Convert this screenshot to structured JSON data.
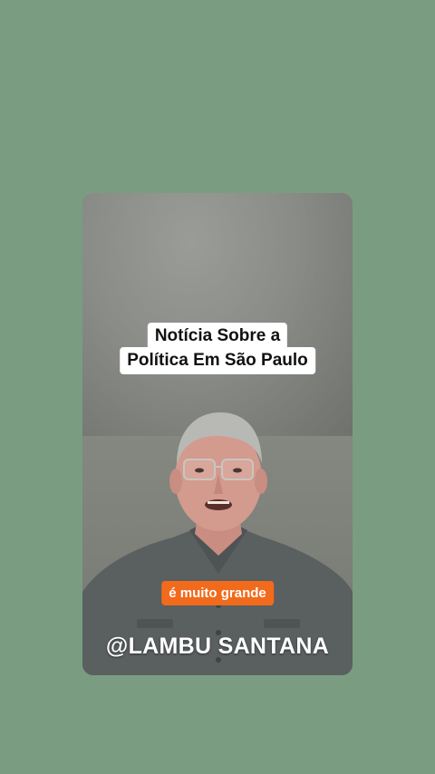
{
  "colors": {
    "background": "#7a9c80",
    "caption_bg": "#f26a1b",
    "title_bg": "#ffffff"
  },
  "video": {
    "title_line1": "Notícia Sobre a",
    "title_line2": "Política Em São Paulo",
    "caption": "é muito grande",
    "handle": "@LAMBU SANTANA"
  }
}
